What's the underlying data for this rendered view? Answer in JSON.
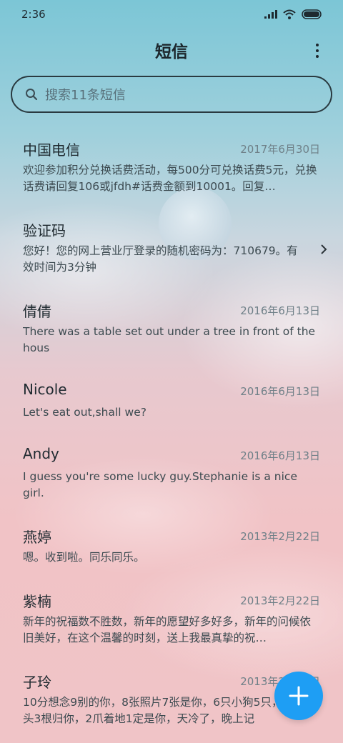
{
  "status_bar": {
    "time": "2:36"
  },
  "header": {
    "title": "短信"
  },
  "search": {
    "placeholder": "搜索11条短信"
  },
  "messages": [
    {
      "name": "中国电信",
      "date": "2017年6月30日",
      "preview": "欢迎参加积分兑换话费活动，每500分可兑换话费5元，兑换话费请回复106或jfdh#话费金额到10001。回复…"
    },
    {
      "name": "验证码",
      "date": "",
      "preview": "您好！您的网上营业厅登录的随机密码为：710679。有效时间为3分钟"
    },
    {
      "name": "倩倩",
      "date": "2016年6月13日",
      "preview": "There was a table set out under a tree in front of the hous"
    },
    {
      "name": "Nicole",
      "date": "2016年6月13日",
      "preview": "Let's eat out,shall we?"
    },
    {
      "name": "Andy",
      "date": "2016年6月13日",
      "preview": "I guess you're some lucky guy.Stephanie is a nice girl."
    },
    {
      "name": "燕婷",
      "date": "2013年2月22日",
      "preview": "嗯。收到啦。同乐同乐。"
    },
    {
      "name": "紫楠",
      "date": "2013年2月22日",
      "preview": "新年的祝福数不胜数，新年的愿望好多好多，新年的问候依旧美好，在这个温馨的时刻，送上我最真挚的祝…"
    },
    {
      "name": "子玲",
      "date": "2013年2月22日",
      "preview": "10分想念9别的你，8张照片7张是你，6只小狗5只，4根骨头3根归你，2爪着地1定是你，天冷了，晚上记"
    }
  ],
  "colors": {
    "fab": "#1e9ef4",
    "text_primary": "#1f2a30",
    "text_secondary": "#6f8088"
  },
  "icons": [
    "signal-icon",
    "wifi-icon",
    "battery-icon",
    "more-icon",
    "search-icon",
    "chevron-right-icon",
    "plus-icon"
  ]
}
